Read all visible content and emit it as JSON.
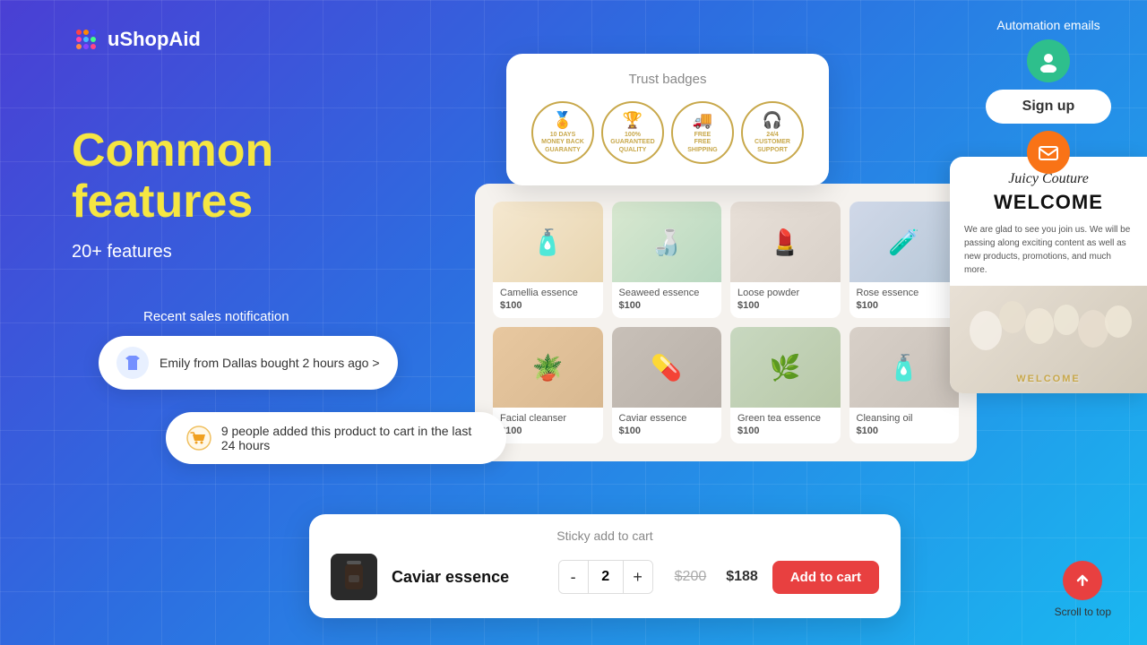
{
  "logo": {
    "text": "uShopAid"
  },
  "hero": {
    "title": "Common features",
    "subtitle": "20+ features"
  },
  "topRight": {
    "automationLabel": "Automation emails",
    "signUpLabel": "Sign up"
  },
  "trustBadges": {
    "title": "Trust badges",
    "badges": [
      {
        "icon": "🏅",
        "line1": "10 DAYS",
        "line2": "MONEY BACK",
        "line3": "GUARANTY"
      },
      {
        "icon": "🏆",
        "line1": "100%",
        "line2": "GUARANTEED",
        "line3": "QUALITY"
      },
      {
        "icon": "🚚",
        "line1": "FREE",
        "line2": "FREE",
        "line3": "SHIPPING"
      },
      {
        "icon": "🎧",
        "line1": "24/4",
        "line2": "CUSTOMER",
        "line3": "SUPPORT"
      }
    ]
  },
  "products": {
    "row1": [
      {
        "name": "Camellia essence",
        "price": "$100",
        "emoji": "🧴"
      },
      {
        "name": "Seaweed essence",
        "price": "$100",
        "emoji": "🍶"
      },
      {
        "name": "Loose powder",
        "price": "$100",
        "emoji": "💄"
      },
      {
        "name": "Rose essence",
        "price": "$100",
        "emoji": "🧪"
      }
    ],
    "row2": [
      {
        "name": "Facial cleanser",
        "price": "$100",
        "emoji": "🪴"
      },
      {
        "name": "Caviar essence",
        "price": "$100",
        "emoji": "💊"
      },
      {
        "name": "Green tea essence",
        "price": "$100",
        "emoji": "🌿"
      },
      {
        "name": "Cleansing oil",
        "price": "$100",
        "emoji": "🧴"
      }
    ]
  },
  "recentSales": {
    "label": "Recent sales notification",
    "notification": "Emily from Dallas bought 2 hours ago >"
  },
  "cartNotification": {
    "text": "9 people added this product to cart in the last 24 hours"
  },
  "juicyCouture": {
    "brand": "Juicy Couture",
    "welcome": "WELCOME",
    "body": "We are glad to see you join us. We will be passing along exciting content as well as new products, promotions, and much more."
  },
  "stickyCart": {
    "label": "Sticky add to cart",
    "productName": "Caviar essence",
    "qty": "2",
    "priceOrig": "$200",
    "priceSale": "$188",
    "addToCartLabel": "Add to cart",
    "minusLabel": "-",
    "plusLabel": "+"
  },
  "scrollTop": {
    "label": "Scroll to top"
  }
}
